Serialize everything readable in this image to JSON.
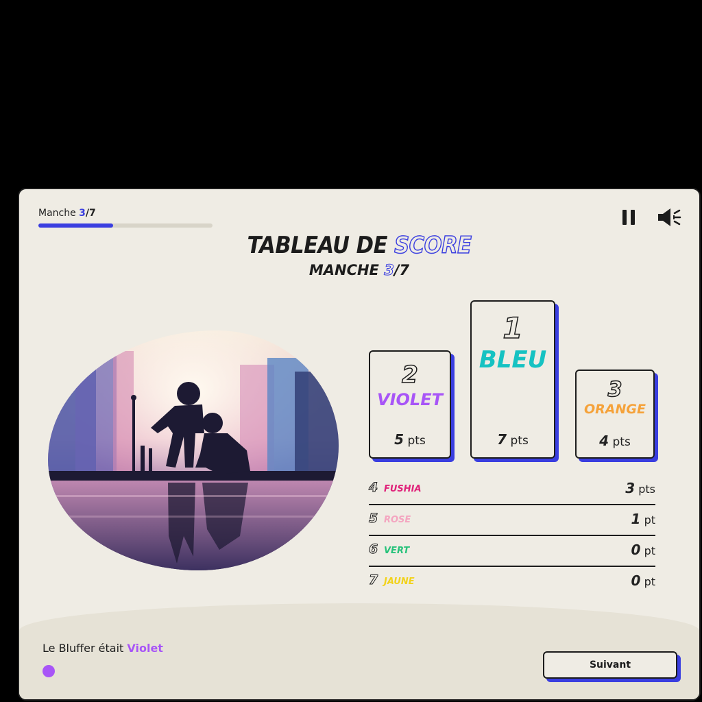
{
  "header": {
    "round_prefix": "Manche ",
    "round_current": "3",
    "round_sep_total": "/7",
    "progress_fraction": 0.43
  },
  "controls": {
    "pause_icon": "pause-icon",
    "sound_icon": "volume-icon"
  },
  "title": {
    "main": "TABLEAU DE ",
    "accent": "SCORE"
  },
  "subtitle": {
    "prefix": "MANCHE ",
    "current": "3",
    "rest": "/7"
  },
  "podium": [
    {
      "rank": "2",
      "team": "VIOLET",
      "points": "5",
      "unit": "pts",
      "color": "#a855f7"
    },
    {
      "rank": "1",
      "team": "BLEU",
      "points": "7",
      "unit": "pts",
      "color": "#16c2c2"
    },
    {
      "rank": "3",
      "team": "ORANGE",
      "points": "4",
      "unit": "pts",
      "color": "#f5a23a"
    }
  ],
  "others": [
    {
      "rank": "4",
      "team": "FUSHIA",
      "points": "3",
      "unit": "pts",
      "color": "#e0227a"
    },
    {
      "rank": "5",
      "team": "ROSE",
      "points": "1",
      "unit": "pt",
      "color": "#f4a5c0"
    },
    {
      "rank": "6",
      "team": "VERT",
      "points": "0",
      "unit": "pt",
      "color": "#27c27a"
    },
    {
      "rank": "7",
      "team": "JAUNE",
      "points": "0",
      "unit": "pt",
      "color": "#f2d21b"
    }
  ],
  "bluffer": {
    "prefix": "Le Bluffer était ",
    "name": "Violet",
    "color": "#a855f7"
  },
  "next_button": {
    "label": "Suivant"
  },
  "colors": {
    "accent": "#3a3ee0",
    "panel": "#efece4",
    "ink": "#1c1c1c"
  }
}
